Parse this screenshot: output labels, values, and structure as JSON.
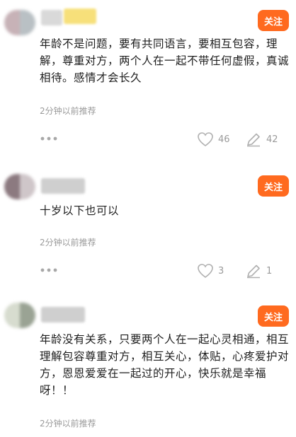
{
  "comments": [
    {
      "follow_label": "关注",
      "content": "年龄不是问题，要有共同语言，要相互包容，理解，尊重对方，两个人在一起不带任何虚假，真诚相待。感情才会长久",
      "meta": "2分钟以前推荐",
      "likes": "46",
      "replies": "42",
      "avatar_colors": [
        "#c7b2b7",
        "#b9c0c4"
      ],
      "name_colors": [
        "#d9d9d9",
        "#f7e07a"
      ]
    },
    {
      "follow_label": "关注",
      "content": "十岁以下也可以",
      "meta": "2分钟以前推荐",
      "likes": "3",
      "replies": "1",
      "avatar_colors": [
        "#8c7a80",
        "#cfc6c9"
      ],
      "name_colors": [
        "#cfcfcf",
        "#dadada"
      ]
    },
    {
      "follow_label": "关注",
      "content": "年龄没有关系，只要两个人在一起心灵相通，相互理解包容尊重对方，相互关心，体贴，心疼爱护对方，恩恩爱爱在一起过的开心，快乐就是幸福呀！！",
      "meta": "2分钟以前推荐",
      "likes": "",
      "replies": "",
      "avatar_colors": [
        "#d7dccf",
        "#9aa394"
      ],
      "name_colors": [
        "#cfcfcf",
        "#d8d8d8"
      ]
    }
  ],
  "colors": {
    "accent": "#ff6a1f",
    "meta_text": "#9a9a9a",
    "body_text": "#1e1e1e"
  },
  "icons": {
    "more": "more-dots-icon",
    "like": "heart-icon",
    "reply": "pen-icon"
  }
}
